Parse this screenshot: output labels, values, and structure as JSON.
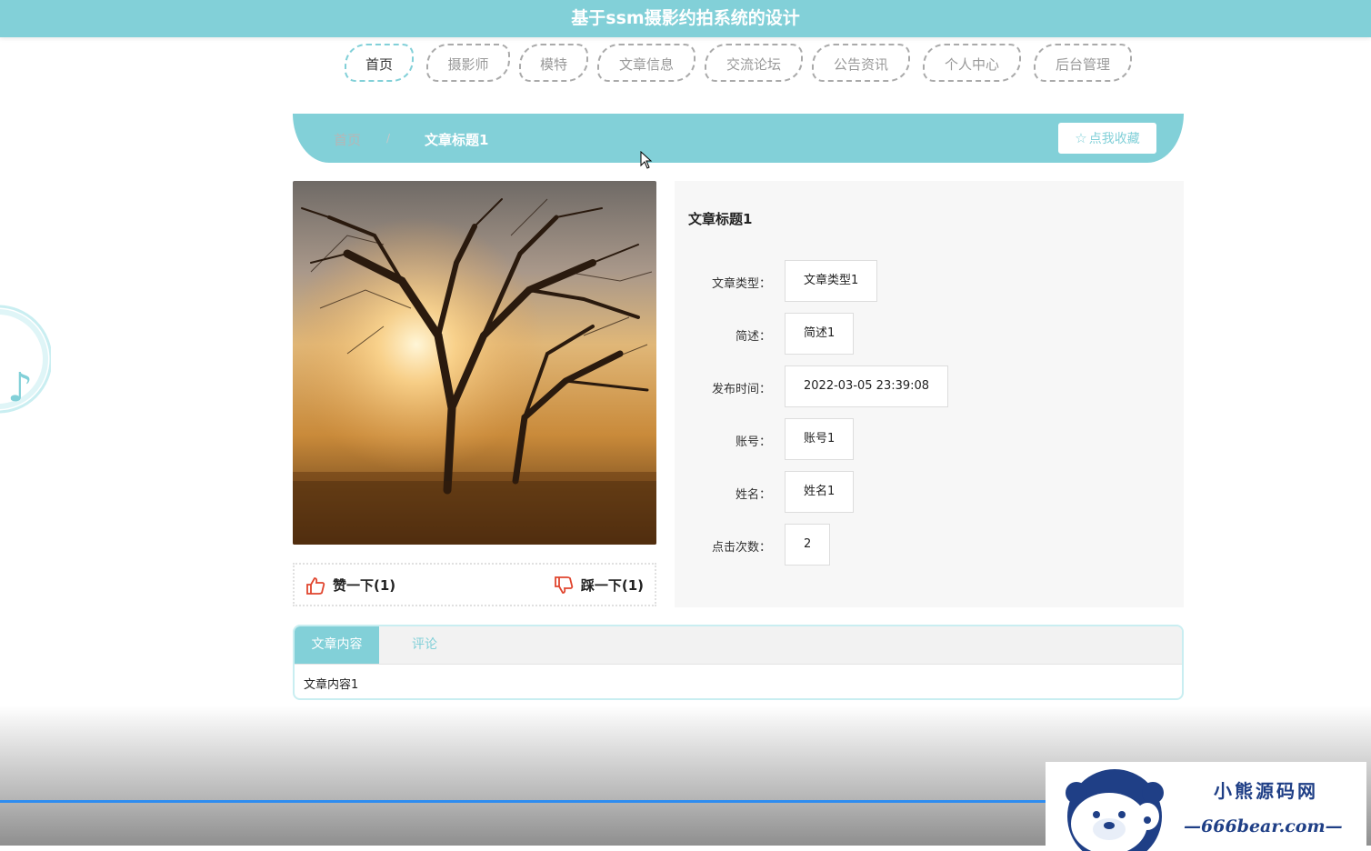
{
  "site": {
    "title": "基于ssm摄影约拍系统的设计"
  },
  "nav": {
    "items": [
      {
        "label": "首页",
        "active": true
      },
      {
        "label": "摄影师"
      },
      {
        "label": "模特"
      },
      {
        "label": "文章信息"
      },
      {
        "label": "交流论坛"
      },
      {
        "label": "公告资讯"
      },
      {
        "label": "个人中心"
      },
      {
        "label": "后台管理"
      }
    ]
  },
  "breadcrumb": {
    "home": "首页",
    "separator": "/",
    "current": "文章标题1"
  },
  "favorite": {
    "label": "点我收藏",
    "icon": "star-outline-icon"
  },
  "photo": {
    "description_icon": "tree-sunset-photo"
  },
  "votes": {
    "up_label": "赞一下(1)",
    "up_icon": "thumbs-up-icon",
    "down_label": "踩一下(1)",
    "down_icon": "thumbs-down-icon"
  },
  "article": {
    "title": "文章标题1",
    "fields": [
      {
        "label": "文章类型：",
        "value": "文章类型1"
      },
      {
        "label": "简述：",
        "value": "简述1"
      },
      {
        "label": "发布时间：",
        "value": "2022-03-05 23:39:08"
      },
      {
        "label": "账号：",
        "value": "账号1"
      },
      {
        "label": "姓名：",
        "value": "姓名1"
      },
      {
        "label": "点击次数：",
        "value": "2"
      }
    ]
  },
  "tabs": {
    "items": [
      {
        "label": "文章内容"
      },
      {
        "label": "评论"
      }
    ],
    "content": "文章内容1"
  },
  "watermark": {
    "line1": "小熊源码网",
    "line2": "—666bear.com—"
  },
  "colors": {
    "accent": "#82d0d8",
    "progress": "#2d8cf0",
    "watermark": "#1f3f86"
  }
}
